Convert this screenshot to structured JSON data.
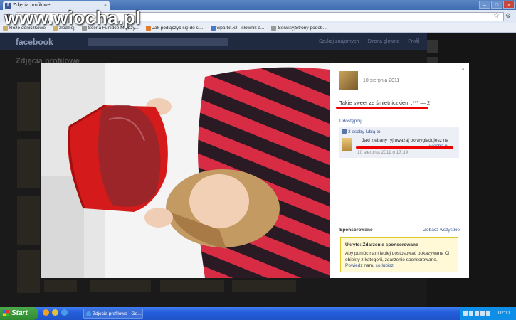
{
  "watermark": "www.wiocha.pl",
  "browser": {
    "tab_title": "Zdjęcia profilowe",
    "tab_close": "×",
    "window_buttons": [
      "–",
      "□",
      "×"
    ],
    "bookmarks": [
      "Róże doniczkowe",
      "złodziej",
      "Scena Funidee Między...",
      "Jak podłączyć się do si...",
      "wpa.txt.xz - słownik a...",
      "Serwisy|Strony podob..."
    ]
  },
  "facebook": {
    "logo": "facebook",
    "nav": [
      "Szukaj znajomych",
      "Strona główna",
      "Profil"
    ],
    "page_title": "Zdjęcia profilowe"
  },
  "photo_panel": {
    "close": "×",
    "date": "10 sierpnia 2011",
    "caption": "Takie sweet ze śmietniczkiem ;*** — 2",
    "share": "Udostępnij",
    "likes": "3 osoby lubią to.",
    "comment": {
      "text": "Jaki zjebany ryj uważaj bo wyglądujesz na",
      "link": "wiocha.pl",
      "date": "10 sierpnia 2011 o 17:39"
    },
    "sponsored": {
      "label": "Sponsorowane",
      "see_all": "Zobacz wszystkie",
      "title": "Ukryto: Zdarzenie sponsorowane",
      "text": "Aby pomóc nam lepiej dostosować pokazywane Ci obiekty z kategorii, zdarzenie sponsorowane.",
      "link1": "Powiedz",
      "text2": "nam,",
      "link2": "co lubisz"
    }
  },
  "taskbar": {
    "start": "Start",
    "window": "Zdjęcia profilowe - Go...",
    "clock": "02:11"
  },
  "colors": {
    "facebook_blue": "#3b5998",
    "red_highlight": "#ee0000",
    "xp_taskbar": "#245edb"
  }
}
